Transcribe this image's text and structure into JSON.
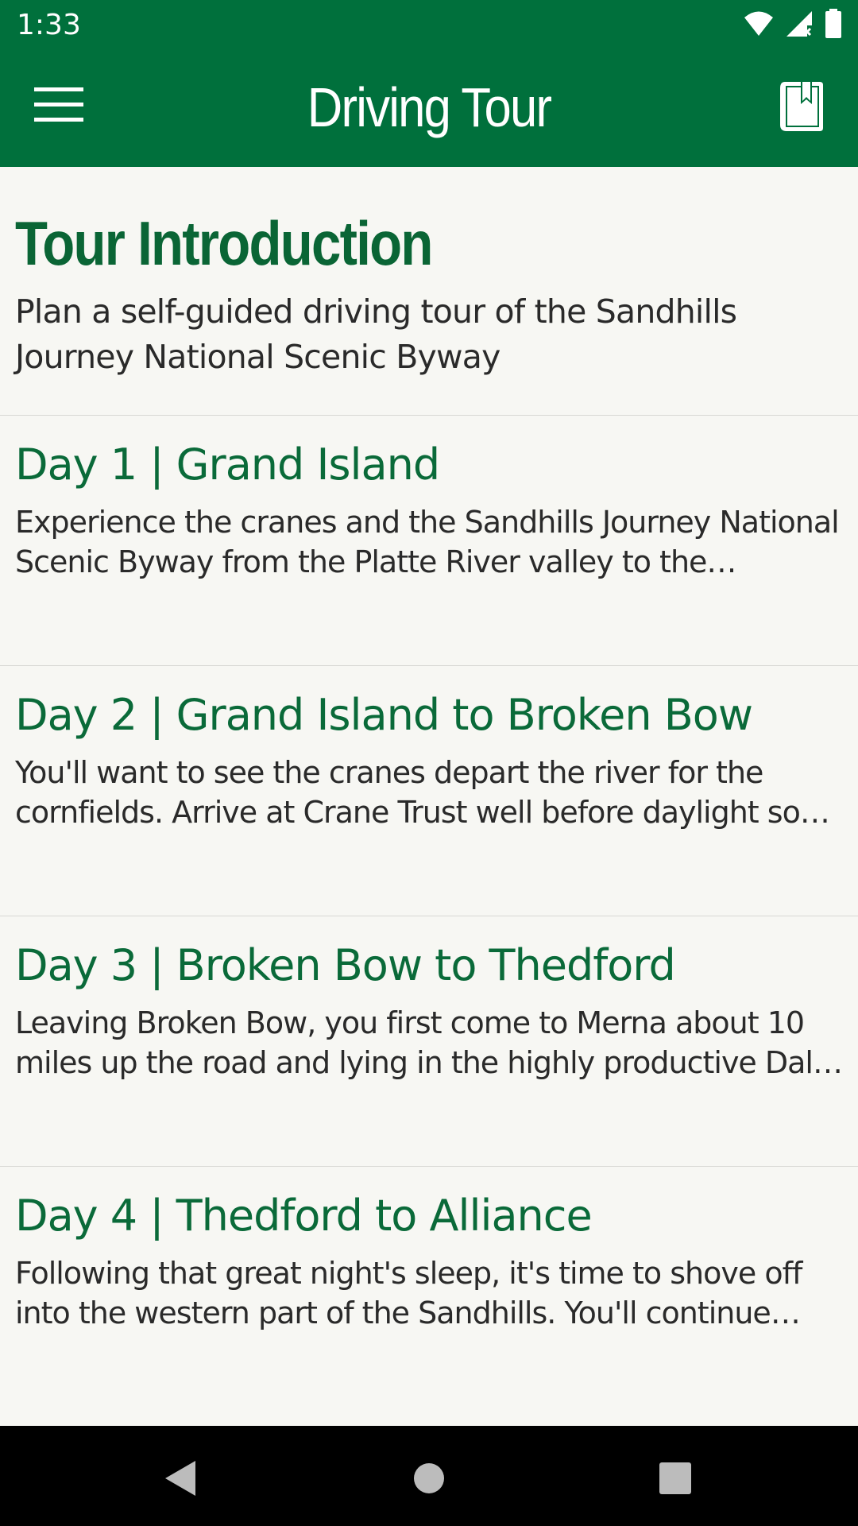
{
  "status_bar": {
    "time": "1:33",
    "icons": [
      "wifi-icon",
      "cell-signal-icon",
      "battery-icon"
    ]
  },
  "app_bar": {
    "title": "Driving Tour",
    "menu_icon": "hamburger-menu-icon",
    "bookmark_icon": "bookmark-book-icon",
    "color": "#00703c"
  },
  "intro": {
    "title": "Tour Introduction",
    "text": "Plan a self-guided driving tour of the Sandhills Journey National Scenic Byway"
  },
  "days": [
    {
      "title": "Day 1 | Grand Island",
      "text": "Experience the cranes and the Sandhills Journey National Scenic Byway from the Platte River valley to the Sandhills and beyond."
    },
    {
      "title": "Day 2 | Grand Island to Broken Bow",
      "text": "You'll want to see the cranes depart the river for the cornfields. Arrive at Crane Trust well before daylight so you can find a spot in the blind."
    },
    {
      "title": "Day 3 | Broken Bow to Thedford",
      "text": "Leaving Broken Bow, you first come to Merna about 10 miles up the road and lying in the highly productive Dale Valley."
    },
    {
      "title": "Day 4 | Thedford to Alliance",
      "text": "Following that great night's sleep, it's time to shove off into the western part of the Sandhills. You'll continue toward Alliance."
    }
  ],
  "nav_bar": {
    "buttons": [
      "back-icon",
      "home-icon",
      "recents-icon"
    ]
  },
  "colors": {
    "primary": "#00703c",
    "heading": "#0a6535",
    "background": "#f7f7f3",
    "body_text": "#2a2a2a"
  }
}
